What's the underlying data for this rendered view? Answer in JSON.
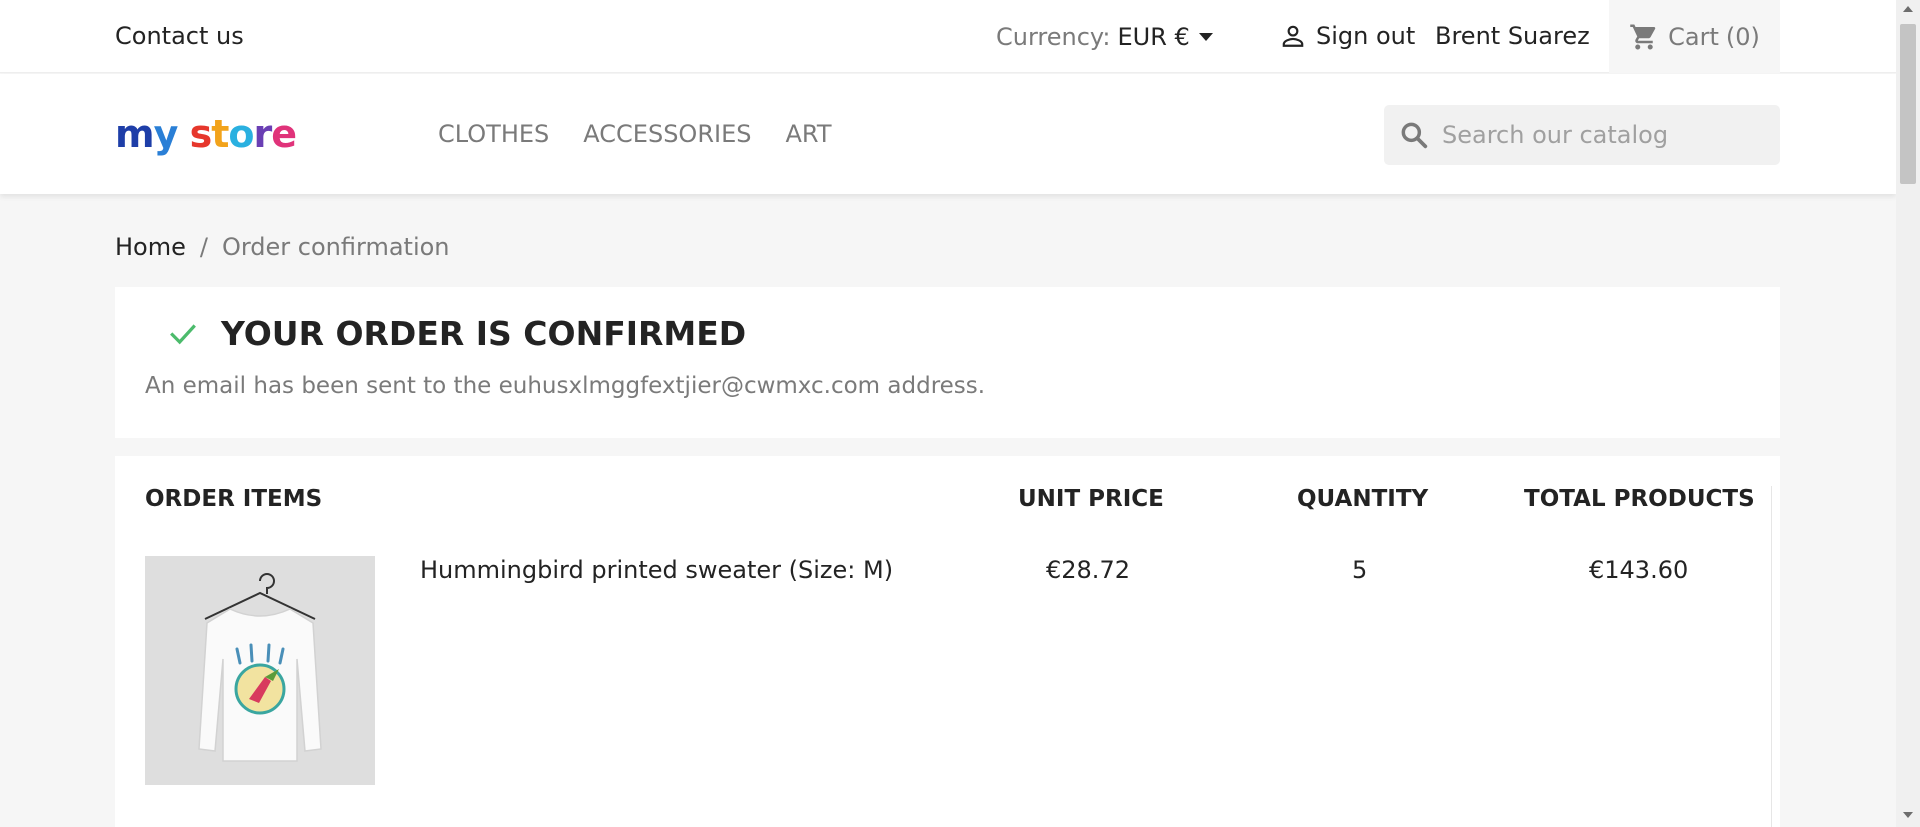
{
  "topbar": {
    "contact_label": "Contact us",
    "currency_label": "Currency:",
    "currency_value": "EUR €",
    "signout_label": "Sign out",
    "user_name": "Brent Suarez",
    "cart_label": "Cart",
    "cart_count": "(0)"
  },
  "header": {
    "logo_letters": [
      "m",
      "y",
      " ",
      "s",
      "t",
      "o",
      "r",
      "e"
    ],
    "logo_colors": [
      "#1e3ea8",
      "#2a7fd6",
      "#ffffff",
      "#e6372c",
      "#f2a31b",
      "#2ab0e0",
      "#6a3fb4",
      "#e0337a"
    ],
    "nav": [
      "CLOTHES",
      "ACCESSORIES",
      "ART"
    ],
    "search_placeholder": "Search our catalog"
  },
  "breadcrumb": {
    "home": "Home",
    "separator": "/",
    "current": "Order confirmation"
  },
  "confirmation": {
    "title": "YOUR ORDER IS CONFIRMED",
    "message": "An email has been sent to the euhusxlmggfextjier@cwmxc.com address.",
    "check_color": "#4cbb6c"
  },
  "order": {
    "headers": {
      "items": "ORDER ITEMS",
      "unit_price": "UNIT PRICE",
      "quantity": "QUANTITY",
      "total": "TOTAL PRODUCTS"
    },
    "items": [
      {
        "name": "Hummingbird printed sweater (Size: M)",
        "unit_price": "€28.72",
        "quantity": "5",
        "total": "€143.60",
        "image_icon": "sweater-icon"
      }
    ]
  }
}
